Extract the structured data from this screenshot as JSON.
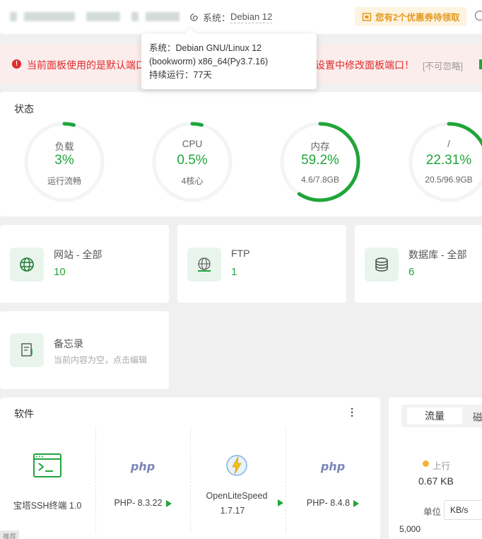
{
  "header": {
    "system_label": "系统：",
    "system_value": "Debian 12",
    "coupon": "您有2个优惠券待领取"
  },
  "tooltip": {
    "line1": "系统：Debian GNU/Linux 12",
    "line2": "(bookworm) x86_64(Py3.7.16)",
    "line3": "持续运行：77天"
  },
  "warning": {
    "text_left": "当前面板使用的是默认端口",
    "text_right": "设置中修改面板端口！",
    "ignore": "[不可忽略]"
  },
  "status": {
    "title": "状态",
    "gauges": [
      {
        "title": "负载",
        "value": "3%",
        "sub": "运行流畅",
        "fraction": 0.03
      },
      {
        "title": "CPU",
        "value": "0.5%",
        "sub": "4核心",
        "fraction": 0.005
      },
      {
        "title": "内存",
        "value": "59.2%",
        "sub": "4.6/7.8GB",
        "fraction": 0.592
      },
      {
        "title": "/",
        "value": "22.31%",
        "sub": "20.5/96.9GB",
        "fraction": 0.2231
      }
    ]
  },
  "cards": {
    "site": {
      "title": "网站 - 全部",
      "value": "10"
    },
    "ftp": {
      "title": "FTP",
      "value": "1"
    },
    "db": {
      "title": "数据库 - 全部",
      "value": "6"
    },
    "memo": {
      "title": "备忘录",
      "sub": "当前内容为空，点击编辑"
    }
  },
  "software": {
    "title": "软件",
    "items": [
      {
        "name": "宝塔SSH终端 1.0"
      },
      {
        "logo": "php",
        "name": "PHP- 8.3.22"
      },
      {
        "name_line1": "OpenLiteSpeed",
        "name_line2": "1.7.17"
      },
      {
        "logo": "php",
        "name": "PHP- 8.4.8"
      }
    ],
    "recommend": "推荐"
  },
  "traffic": {
    "tab_active": "流量",
    "tab_next": "磁",
    "up_label": "上行",
    "up_value": "0.67 KB",
    "unit_label": "单位",
    "unit_value": "KB/s",
    "axis_top": "5,000"
  },
  "colors": {
    "accent": "#20a53a",
    "warning": "#e02b2b",
    "coupon": "#e39a1e"
  }
}
